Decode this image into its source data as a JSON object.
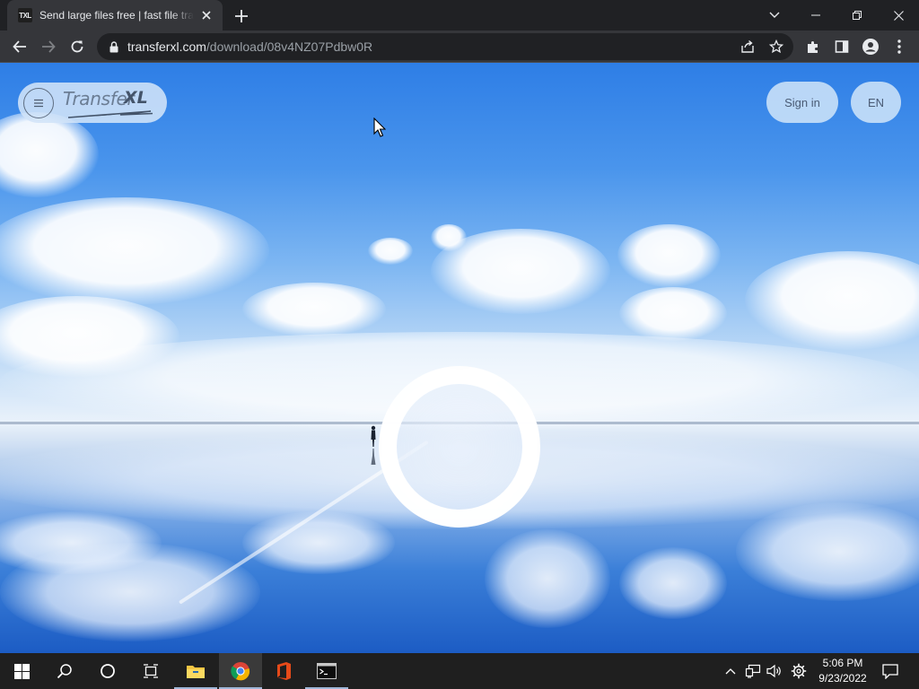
{
  "browser": {
    "tab": {
      "favicon_text": "TXL",
      "title": "Send large files free | fast file transfer"
    },
    "url_host": "transferxl.com",
    "url_path": "/download/08v4NZ07Pdbw0R"
  },
  "header": {
    "brand_transfer": "Transfer",
    "brand_xl": "XL",
    "sign_in_label": "Sign in",
    "language_label": "EN"
  },
  "taskbar": {
    "time": "5:06 PM",
    "date": "9/23/2022"
  },
  "colors": {
    "sky_top": "#2e7ee6",
    "pill_bg": "#c5def7",
    "pill_text": "#4a5b74",
    "chrome_dark": "#202124",
    "chrome_toolbar": "#35363a",
    "taskbar": "#1f1f1f"
  }
}
